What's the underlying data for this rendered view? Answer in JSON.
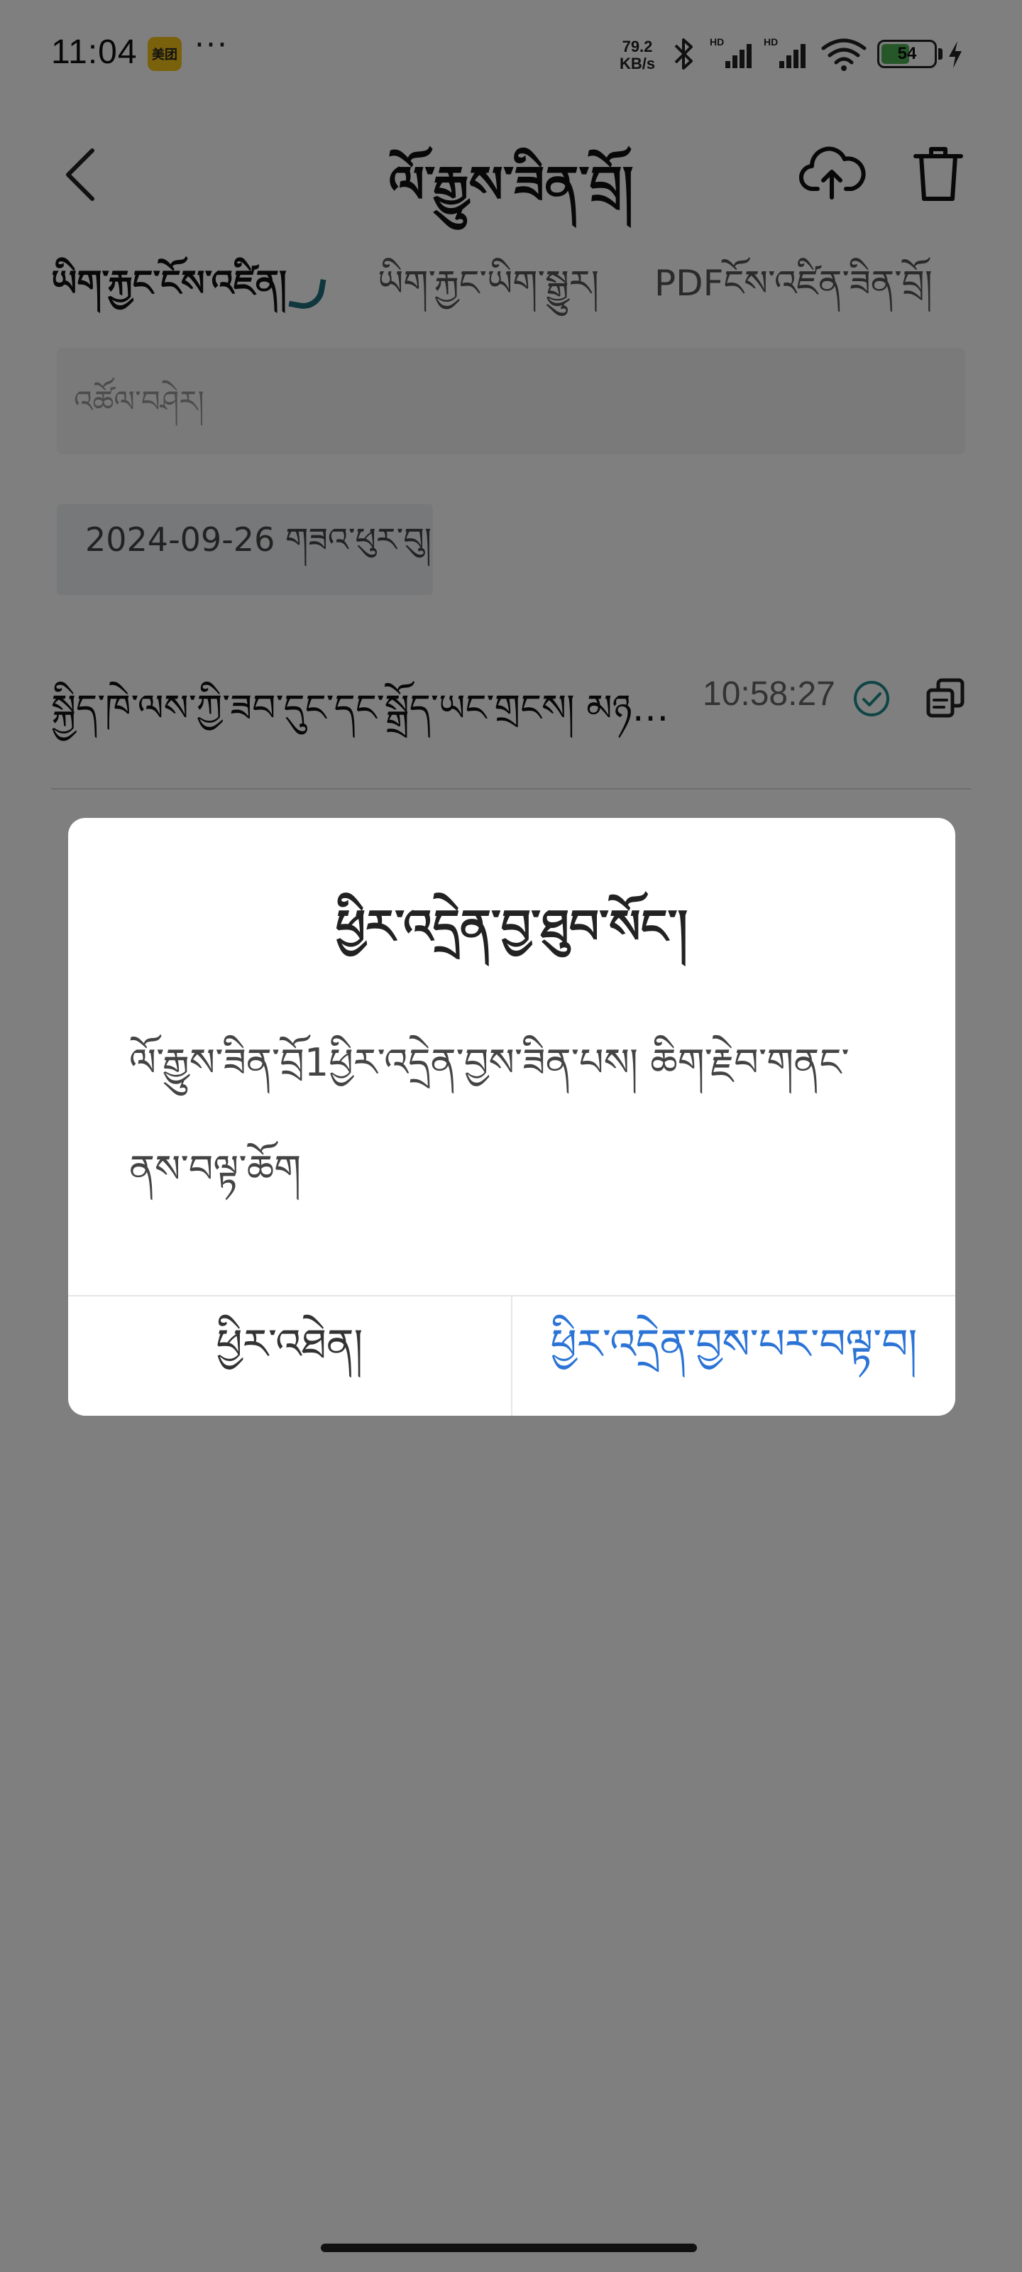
{
  "status_bar": {
    "time": "11:04",
    "app_badge": "美团",
    "more": "···",
    "net_speed_value": "79.2",
    "net_speed_unit": "KB/s",
    "battery": "54",
    "battery_level": 0.54
  },
  "header": {
    "title": "ལོ་རྒྱུས་ཟིན་བྲོ།"
  },
  "tabs": [
    {
      "label": "ཡིག་རྐྱང་ངོས་འཛིན།",
      "active": true
    },
    {
      "label": "ཡིག་རྐྱང་ཡིག་སྒྱུར།",
      "active": false
    },
    {
      "label": "PDFངོས་འཛིན་ཟིན་བྲོ།",
      "active": false
    }
  ],
  "search": {
    "placeholder": "འཚོལ་བཤེར།"
  },
  "date_filter": {
    "label": "2024-09-26 གཟའ་ཕུར་བུ།"
  },
  "record": {
    "text": "སྐྱིད་ཁེ་ལས་ཀྱི་ཟབ་དུང་དང་སྒྲོད་ཡང་གྲངས། མཉམ་འ···",
    "time": "10:58:27"
  },
  "dialog": {
    "title": "ཕྱིར་འདྲེན་བྱ་ཐུབ་སོང་།",
    "message": "ལོ་རྒྱུས་ཟིན་བྲོ1ཕྱིར་འདྲེན་བྱས་ཟིན་པས། ཆིག་རྗེབ་གནང་ནས་བལྟ་ཆོག",
    "cancel_label": "ཕྱིར་འཐེན།",
    "confirm_label": "ཕྱིར་འདྲེན་བྱས་པར་བལྟ་བ།"
  },
  "colors": {
    "accent": "#2b74d6",
    "tab_indicator": "#1f6e7a",
    "check": "#1f8a8a",
    "overlay": "rgba(0,0,0,0.5)"
  },
  "icons": {
    "back": "chevron-left-icon",
    "upload": "cloud-upload-icon",
    "delete": "trash-icon",
    "check": "check-circle-icon",
    "copy": "copy-icon"
  }
}
